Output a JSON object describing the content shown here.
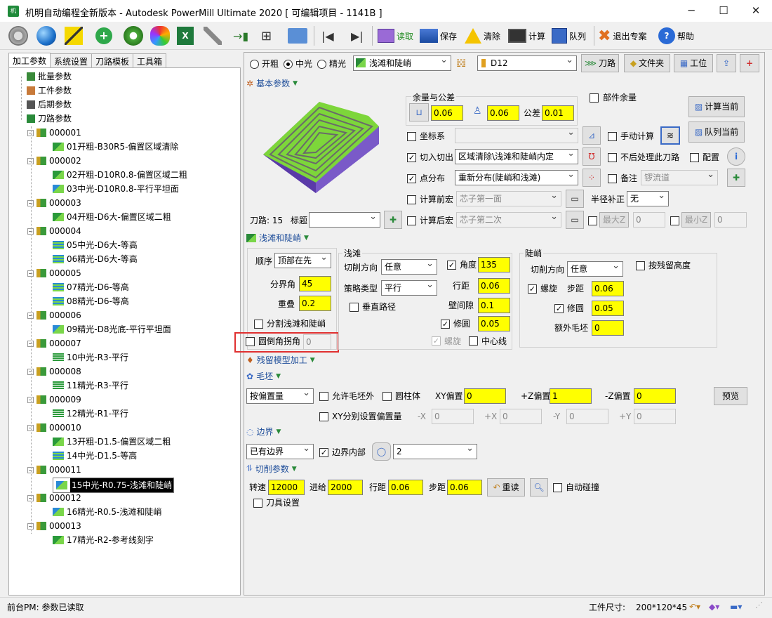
{
  "window": {
    "title": "机明自动编程全新版本 - Autodesk PowerMill Ultimate 2020    [ 可编辑项目 - 1141B ]",
    "app_icon": "机",
    "min": "─",
    "max": "☐",
    "close": "✕"
  },
  "toolbar": {
    "read": "读取",
    "save": "保存",
    "clear": "清除",
    "calc": "计算",
    "queue": "队列",
    "exit": "退出专案",
    "help": "帮助"
  },
  "tabs": [
    "加工参数",
    "系统设置",
    "刀路模板",
    "工具箱"
  ],
  "tree": {
    "root": [
      {
        "label": "批量参数"
      },
      {
        "label": "工件参数"
      },
      {
        "label": "后期参数"
      },
      {
        "label": "刀路参数"
      }
    ],
    "groups": [
      {
        "id": "000001",
        "items": [
          "01开粗-B30R5-偏置区域清除"
        ]
      },
      {
        "id": "000002",
        "items": [
          "02开粗-D10R0.8-偏置区域二粗",
          "03中光-D10R0.8-平行平坦面"
        ]
      },
      {
        "id": "000003",
        "items": [
          "04开粗-D6大-偏置区域二粗"
        ]
      },
      {
        "id": "000004",
        "items": [
          "05中光-D6大-等高",
          "06精光-D6大-等高"
        ]
      },
      {
        "id": "000005",
        "items": [
          "07精光-D6-等高",
          "08精光-D6-等高"
        ]
      },
      {
        "id": "000006",
        "items": [
          "09精光-D8光底-平行平坦面"
        ]
      },
      {
        "id": "000007",
        "items": [
          "10中光-R3-平行"
        ]
      },
      {
        "id": "000008",
        "items": [
          "11精光-R3-平行"
        ]
      },
      {
        "id": "000009",
        "items": [
          "12精光-R1-平行"
        ]
      },
      {
        "id": "000010",
        "items": [
          "13开粗-D1.5-偏置区域二粗",
          "14中光-D1.5-等高"
        ]
      },
      {
        "id": "000011",
        "items": [
          "15中光-R0.75-浅滩和陡峭"
        ]
      },
      {
        "id": "000012",
        "items": [
          "16精光-R0.5-浅滩和陡峭"
        ]
      },
      {
        "id": "000013",
        "items": [
          "17精光-R2-参考线刻字"
        ]
      }
    ],
    "selected": "15中光-R0.75-浅滩和陡峭"
  },
  "top": {
    "radio_rough": "开粗",
    "radio_mid": "中光",
    "radio_fine": "精光",
    "strategy": "浅滩和陡峭",
    "tool": "D12",
    "btn_toolpath": "刀路",
    "btn_folder": "文件夹",
    "btn_station": "工位"
  },
  "basic": {
    "title": "基本参数",
    "allowance_title": "余量与公差",
    "allow1": "0.06",
    "allow2": "0.06",
    "tol_label": "公差",
    "tol": "0.01",
    "part_allow": "部件余量",
    "calc_current": "计算当前",
    "queue_current": "队列当前",
    "coord": "坐标系",
    "manual_calc": "手动计算",
    "inout": "切入切出",
    "inout_val": "区域清除\\浅滩和陡峭内定",
    "no_process": "不后处理此刀路",
    "config": "配置",
    "point_dist": "点分布",
    "point_val": "重新分布(陡峭和浅滩)",
    "note": "备注",
    "note_val": "锣流道",
    "pre_macro": "计算前宏",
    "pre_macro_val": "芯子第一面",
    "radius_comp": "半径补正",
    "radius_comp_val": "无",
    "post_macro": "计算后宏",
    "post_macro_val": "芯子第二次",
    "max_z": "最大Z",
    "max_z_val": "0",
    "min_z": "最小Z",
    "min_z_val": "0",
    "toolpath_label": "刀路:",
    "toolpath_num": "15",
    "title_label": "标题"
  },
  "shallow_steep": {
    "title": "浅滩和陡峭",
    "order": "顺序",
    "order_val": "顶部在先",
    "boundary_angle": "分界角",
    "boundary_val": "45",
    "overlap": "重叠",
    "overlap_val": "0.2",
    "split": "分割浅滩和陡峭",
    "chamfer": "圆倒角拐角",
    "chamfer_val": "0",
    "shallow": {
      "title": "浅滩",
      "cut_dir": "切削方向",
      "cut_dir_val": "任意",
      "angle": "角度",
      "angle_val": "135",
      "strategy_type": "策略类型",
      "strategy_type_val": "平行",
      "stepover": "行距",
      "stepover_val": "0.06",
      "vertical": "垂直路径",
      "wall_gap": "壁间隙",
      "wall_gap_val": "0.1",
      "fillet": "修圆",
      "fillet_val": "0.05",
      "spiral": "螺旋",
      "centerline": "中心线"
    },
    "steep": {
      "title": "陡峭",
      "cut_dir": "切削方向",
      "cut_dir_val": "任意",
      "by_scallop": "按残留高度",
      "spiral": "螺旋",
      "step": "步距",
      "step_val": "0.06",
      "fillet": "修圆",
      "fillet_val": "0.05",
      "extra": "额外毛坯",
      "extra_val": "0"
    }
  },
  "residual": {
    "title": "残留模型加工"
  },
  "blank": {
    "title": "毛坯",
    "type": "按偏置量",
    "allow_outside": "允许毛坯外",
    "cylinder": "圆柱体",
    "xy_off": "XY偏置",
    "xy_val": "0",
    "pz_off": "+Z偏置",
    "pz_val": "1",
    "mz_off": "-Z偏置",
    "mz_val": "0",
    "preview": "预览",
    "xy_sep": "XY分别设置偏置量",
    "mx": "-X",
    "mx_val": "0",
    "px": "+X",
    "px_val": "0",
    "my": "-Y",
    "my_val": "0",
    "py": "+Y",
    "py_val": "0"
  },
  "boundary": {
    "title": "边界",
    "type": "已有边界",
    "inside": "边界内部",
    "val": "2"
  },
  "cutting": {
    "title": "切削参数",
    "speed": "转速",
    "speed_val": "12000",
    "feed": "进给",
    "feed_val": "2000",
    "stepover": "行距",
    "stepover_val": "0.06",
    "step": "步距",
    "step_val": "0.06",
    "reread": "重读",
    "auto_collide": "自动碰撞",
    "tool_setting": "刀具设置"
  },
  "status": {
    "left": "前台PM: 参数已读取",
    "size_label": "工件尺寸:",
    "size_val": "200*120*45"
  },
  "colors": {
    "highlight": "#ffff00",
    "red_box": "#e03030",
    "model_green": "#7dd63a",
    "model_purple": "#7a5ac8"
  }
}
